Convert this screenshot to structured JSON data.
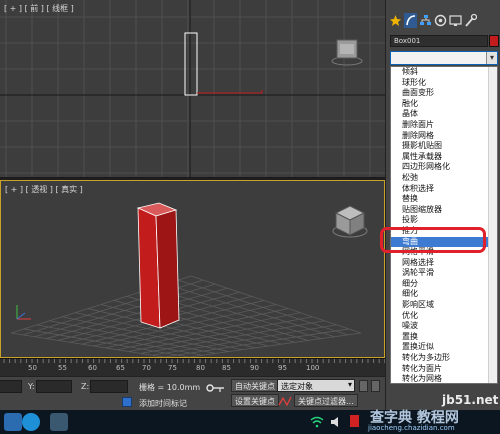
{
  "viewports": {
    "top_label": "[ + ] [ 前 ] [ 线框 ]",
    "persp_label": "[ + ] [ 透视 ] [ 真实 ]"
  },
  "timeline": {
    "ticks": [
      "50",
      "55",
      "60",
      "65",
      "70",
      "75",
      "80",
      "85",
      "90",
      "95",
      "100"
    ]
  },
  "status": {
    "x_label": "X:",
    "y_label": "Y:",
    "z_label": "Z:",
    "grid_text": "栅格 = 10.0mm",
    "add_time_tag": "添加时间标记",
    "auto_key": "自动关键点",
    "selected_object": "选定对象",
    "set_key": "设置关键点",
    "key_filters": "关键点过滤器..."
  },
  "command_panel": {
    "object_name": "Box001",
    "object_color": "#c31c1c",
    "modifiers": [
      "倾斜",
      "球形化",
      "曲面变形",
      "融化",
      "晶体",
      "删除面片",
      "删除网格",
      "摄影机贴图",
      "属性承载器",
      "四边形网格化",
      "松弛",
      "体积选择",
      "替换",
      "贴图缩放器",
      "投影",
      "推力",
      "弯曲",
      "网格平滑",
      "网格选择",
      "涡轮平滑",
      "细分",
      "细化",
      "影响区域",
      "优化",
      "噪波",
      "置换",
      "置换近似",
      "转化为多边形",
      "转化为面片",
      "转化为网格"
    ],
    "selected_modifier": "弯曲"
  },
  "watermark": {
    "site": "jb51.net",
    "brand": "查字典 教程网",
    "url": "jiaocheng.chazidian.com"
  },
  "colors": {
    "viewport_bg": "#3d3d3d",
    "active_viewport_border": "#c9a227",
    "box_color": "#c31c1c",
    "selection_blue": "#3d7ad1",
    "highlight_ring": "#e0202a"
  }
}
